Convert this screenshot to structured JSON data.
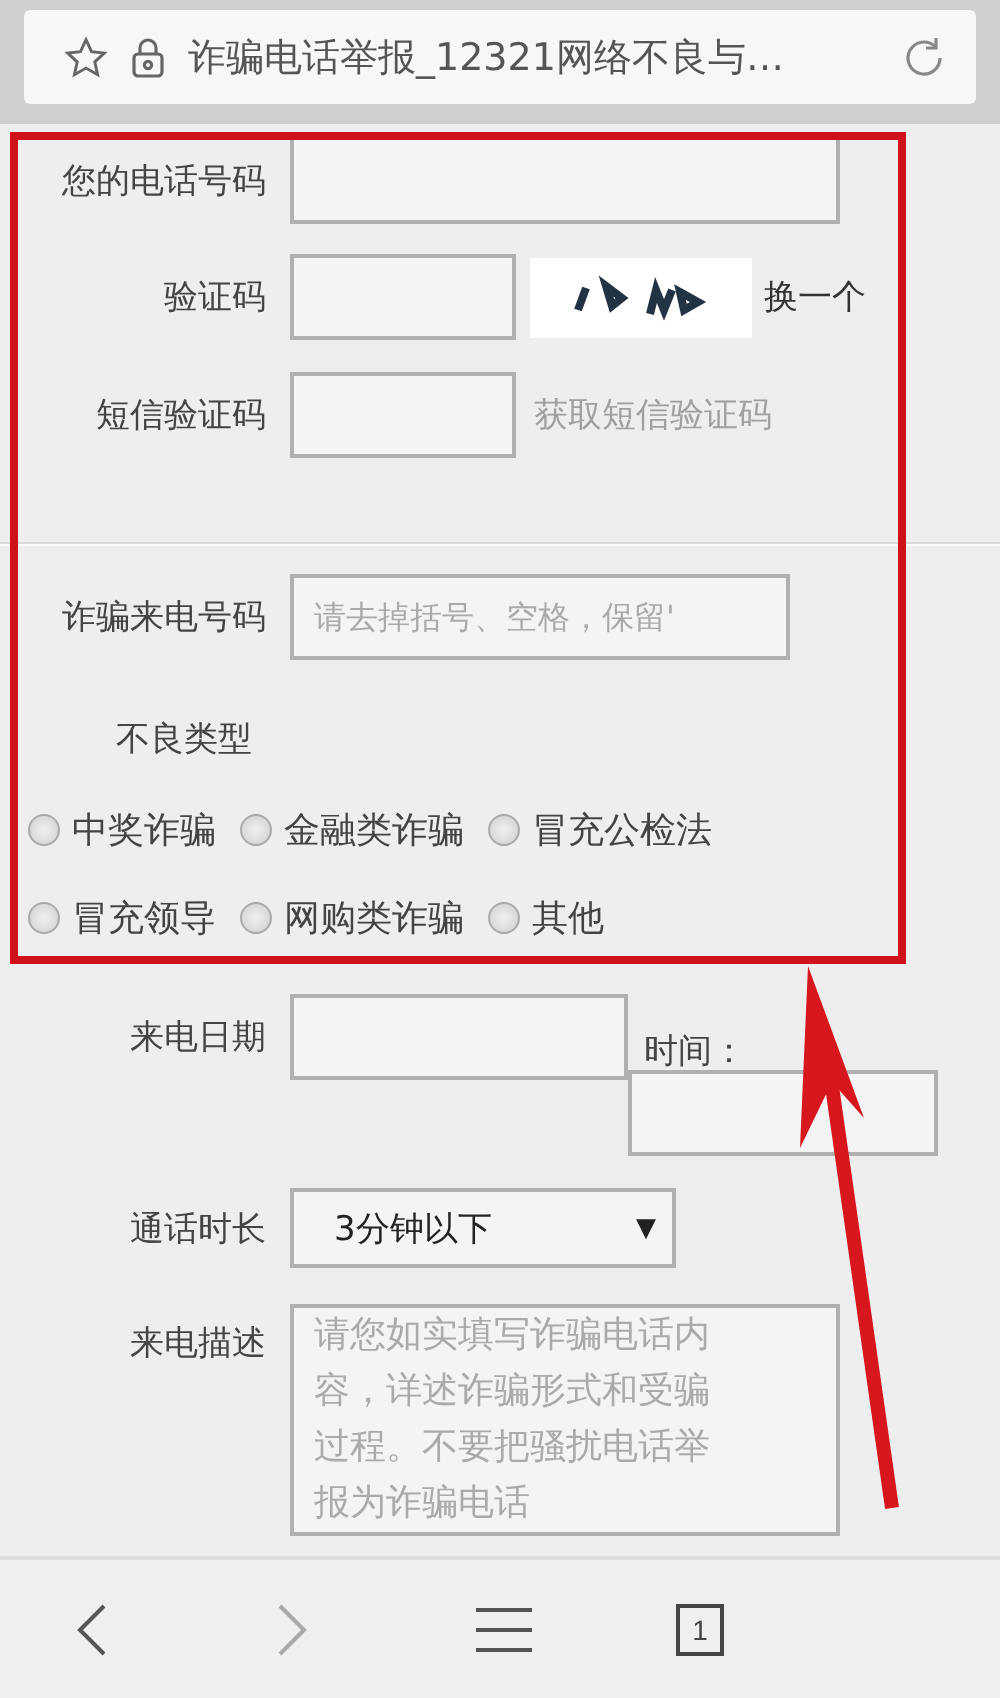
{
  "address_bar": {
    "title": "诈骗电话举报_12321网络不良与…"
  },
  "phone": {
    "label": "您的电话号码"
  },
  "captcha": {
    "label": "验证码",
    "refresh": "换一个"
  },
  "sms_code": {
    "label": "短信验证码",
    "action": "获取短信验证码"
  },
  "caller_number": {
    "label": "诈骗来电号码",
    "placeholder": "请去掉括号、空格，保留'"
  },
  "type_label": "不良类型",
  "types": [
    {
      "label": "中奖诈骗",
      "selected": false
    },
    {
      "label": "金融类诈骗",
      "selected": false
    },
    {
      "label": "冒充公检法",
      "selected": false
    },
    {
      "label": "冒充领导",
      "selected": false
    },
    {
      "label": "网购类诈骗",
      "selected": false
    },
    {
      "label": "其他",
      "selected": false
    }
  ],
  "call_date": {
    "label": "来电日期",
    "time_label": "时间："
  },
  "duration": {
    "label": "通话时长",
    "value": "3分钟以下",
    "caret": "▼"
  },
  "description": {
    "label": "来电描述",
    "placeholder": "请您如实填写诈骗电话内容，详述诈骗形式和受骗过程。不要把骚扰电话举报为诈骗电话"
  },
  "toolbar": {
    "tab_count": "1",
    "forward_disabled": true
  }
}
